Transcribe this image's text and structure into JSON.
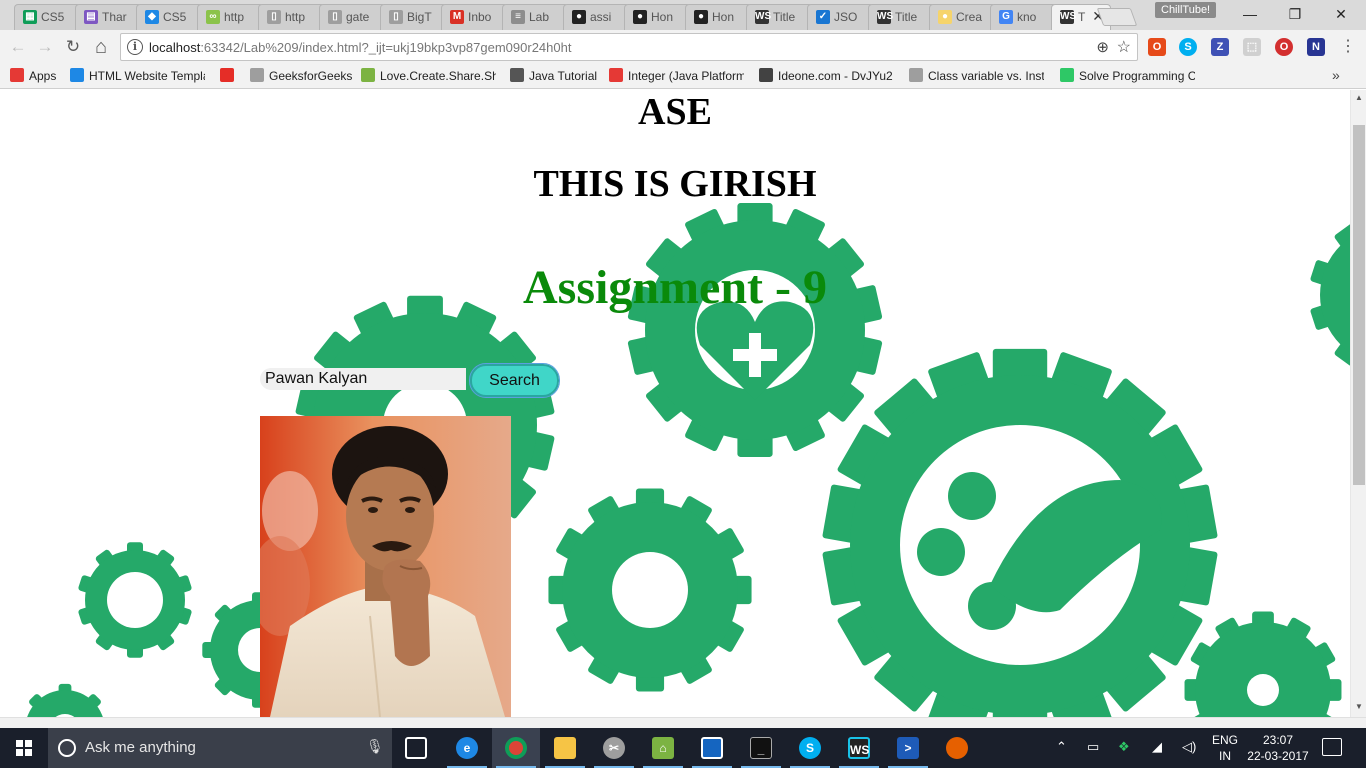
{
  "browser": {
    "tabs": [
      {
        "title": "CS5",
        "fav_color": "#0f9d58",
        "fav": "▦"
      },
      {
        "title": "Thar",
        "fav_color": "#7e57c2",
        "fav": "▤"
      },
      {
        "title": "CS5",
        "fav_color": "#1e88e5",
        "fav": "◆"
      },
      {
        "title": "http",
        "fav_color": "#8bc34a",
        "fav": "∞"
      },
      {
        "title": "http",
        "fav_color": "#9e9e9e",
        "fav": "▯"
      },
      {
        "title": "gate",
        "fav_color": "#9e9e9e",
        "fav": "▯"
      },
      {
        "title": "BigT",
        "fav_color": "#9e9e9e",
        "fav": "▯"
      },
      {
        "title": "Inbo",
        "fav_color": "#d93025",
        "fav": "M"
      },
      {
        "title": "Lab",
        "fav_color": "#8d8d8d",
        "fav": "≡"
      },
      {
        "title": "assi",
        "fav_color": "#222222",
        "fav": "●"
      },
      {
        "title": "Hon",
        "fav_color": "#222222",
        "fav": "●"
      },
      {
        "title": "Hon",
        "fav_color": "#222222",
        "fav": "●"
      },
      {
        "title": "Title",
        "fav_color": "#333333",
        "fav": "WS"
      },
      {
        "title": "JSO",
        "fav_color": "#1976d2",
        "fav": "✓"
      },
      {
        "title": "Title",
        "fav_color": "#333333",
        "fav": "WS"
      },
      {
        "title": "Crea",
        "fav_color": "#f6d46b",
        "fav": "●"
      },
      {
        "title": "kno",
        "fav_color": "#4285f4",
        "fav": "G"
      },
      {
        "title": "T",
        "fav_color": "#333333",
        "fav": "WS"
      }
    ],
    "tab_close": "✕",
    "profile_label": "ChillTube!",
    "window_controls": {
      "minimize": "—",
      "maximize": "❐",
      "close": "✕"
    },
    "nav": {
      "back": "←",
      "forward": "→",
      "reload": "↻",
      "home": "⌂"
    },
    "url_host": "localhost",
    "url_rest": ":63342/Lab%209/index.html?_ijt=ukj19bkp3vp87gem090r24h0ht",
    "bookmarks": [
      {
        "label": "Apps",
        "icon_color": "#e53935"
      },
      {
        "label": "HTML Website Templa",
        "icon_color": "#1e88e5"
      },
      {
        "label": "",
        "icon_color": "#e52d27"
      },
      {
        "label": "GeeksforGeeks",
        "icon_color": "#9e9e9e"
      },
      {
        "label": "Love.Create.Share.Sho",
        "icon_color": "#7cb342"
      },
      {
        "label": "Java Tutorial",
        "icon_color": "#555555"
      },
      {
        "label": "Integer (Java Platform",
        "icon_color": "#e53935"
      },
      {
        "label": "Ideone.com - DvJYu2",
        "icon_color": "#424242"
      },
      {
        "label": "Class variable vs. Insta",
        "icon_color": "#9e9e9e"
      },
      {
        "label": "Solve Programming C",
        "icon_color": "#2ec866"
      }
    ],
    "bookmarks_more": "»"
  },
  "page": {
    "heading1": "ASE",
    "heading2": "THIS IS GIRISH",
    "heading3": "Assignment - 9",
    "search_value": "Pawan Kalyan",
    "search_button": "Search",
    "accent_green": "#25a969",
    "assignment_color": "#0a8a0a",
    "button_color": "#40d6c8"
  },
  "taskbar": {
    "search_placeholder": "Ask me anything",
    "language": "ENG",
    "region": "IN",
    "time": "23:07",
    "date": "22-03-2017"
  }
}
